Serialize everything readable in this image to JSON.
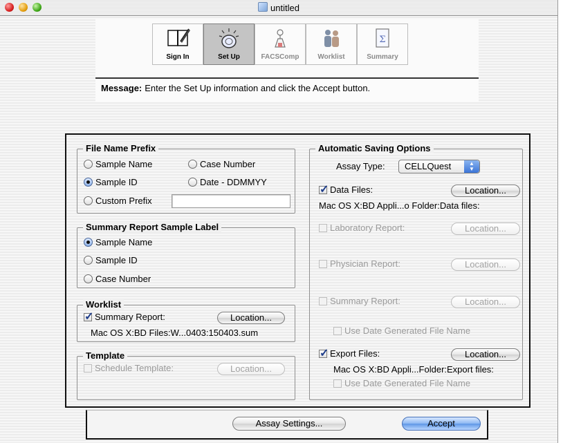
{
  "window": {
    "title": "untitled"
  },
  "toolbar": {
    "tabs": [
      {
        "label": "Sign In",
        "icon": "notebook-icon",
        "active": false,
        "enabled": true
      },
      {
        "label": "Set Up",
        "icon": "setup-light-icon",
        "active": true,
        "enabled": true
      },
      {
        "label": "FACSComp",
        "icon": "flask-icon",
        "active": false,
        "enabled": false
      },
      {
        "label": "Worklist",
        "icon": "people-icon",
        "active": false,
        "enabled": false
      },
      {
        "label": "Summary",
        "icon": "sigma-document-icon",
        "active": false,
        "enabled": false
      }
    ]
  },
  "message": {
    "label": "Message:",
    "text": "Enter the Set Up information and click the Accept button."
  },
  "file_name_prefix": {
    "title": "File Name Prefix",
    "sample_name": "Sample Name",
    "case_number": "Case Number",
    "sample_id": "Sample ID",
    "date": "Date - DDMMYY",
    "custom_prefix": "Custom Prefix",
    "custom_prefix_value": "",
    "selected": "Sample ID"
  },
  "summary_label": {
    "title": "Summary Report Sample Label",
    "sample_name": "Sample Name",
    "sample_id": "Sample ID",
    "case_number": "Case Number",
    "selected": "Sample Name"
  },
  "worklist": {
    "title": "Worklist",
    "summary_report": "Summary Report:",
    "checked": true,
    "location_btn": "Location...",
    "path": "Mac OS X:BD Files:W...0403:150403.sum"
  },
  "template": {
    "title": "Template",
    "schedule_template": "Schedule Template:",
    "location_btn": "Location..."
  },
  "auto_save": {
    "title": "Automatic Saving Options",
    "assay_type_label": "Assay Type:",
    "assay_type_value": "CELLQuest",
    "data_files": "Data Files:",
    "data_files_checked": true,
    "data_files_path": "Mac OS X:BD Appli...o Folder:Data files:",
    "laboratory_report": "Laboratory Report:",
    "physician_report": "Physician Report:",
    "summary_report": "Summary Report:",
    "use_date_1": "Use Date Generated File Name",
    "export_files": "Export Files:",
    "export_files_checked": true,
    "export_files_path": "Mac OS X:BD Appli...Folder:Export files:",
    "use_date_2": "Use Date Generated File Name",
    "location_btn": "Location..."
  },
  "footer": {
    "assay_settings": "Assay Settings...",
    "accept": "Accept"
  },
  "colors": {
    "accent": "#5f97e6",
    "disabled_text": "#9a9a9a"
  }
}
